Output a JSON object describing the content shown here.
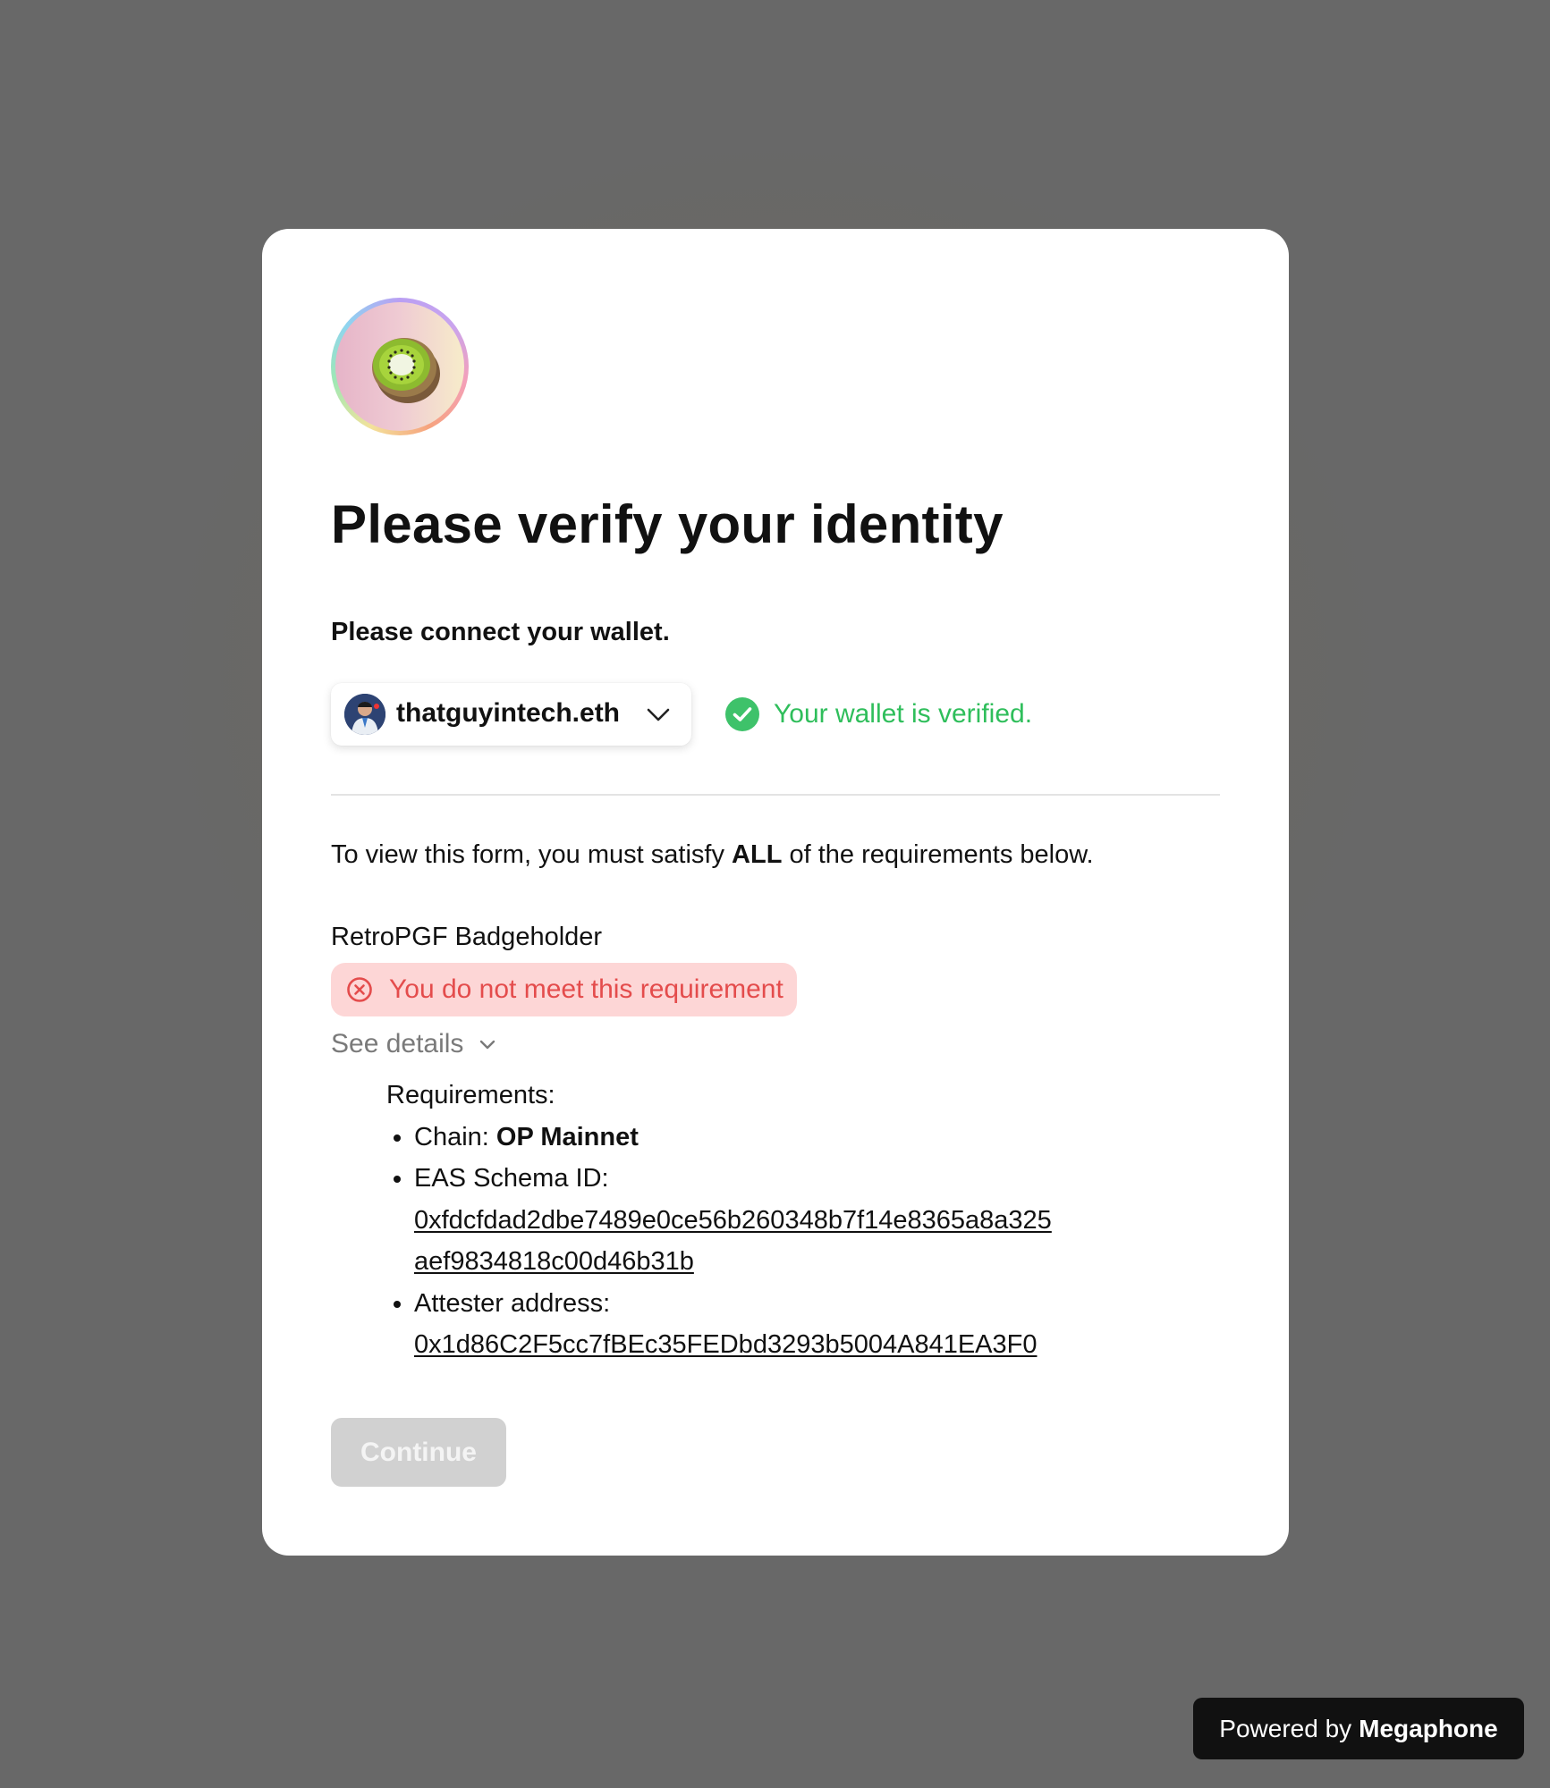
{
  "form": {
    "logo_icon": "kiwi-icon",
    "title": "Please verify your identity",
    "connect_prompt": "Please connect your wallet."
  },
  "wallet": {
    "name": "thatguyintech.eth",
    "avatar_icon": "user-avatar",
    "dropdown_icon": "chevron-down-icon",
    "status_text": "Your wallet is verified.",
    "status_color": "#2fbe5b"
  },
  "requirements": {
    "intro_prefix": "To view this form, you must satisfy",
    "intro_emphasis": "ALL",
    "intro_suffix": "of the requirements below.",
    "items": [
      {
        "name": "RetroPGF Badgeholder",
        "status_text": "You do not meet this requirement",
        "status_color": "#e44c4c",
        "details_toggle": "See details",
        "details": {
          "title": "Requirements:",
          "chain_label": "Chain:",
          "chain_value": "OP Mainnet",
          "schema_label": "EAS Schema ID:",
          "schema_id_line1": "0xfdcfdad2dbe7489e0ce56b260348b7f14e8365a8a325",
          "schema_id_line2": "aef9834818c00d46b31b",
          "attester_label": "Attester address:",
          "attester_address": "0x1d86C2F5cc7fBEc35FEDbd3293b5004A841EA3F0"
        }
      }
    ]
  },
  "actions": {
    "continue_label": "Continue",
    "continue_disabled": true
  },
  "footer": {
    "powered_prefix": "Powered by",
    "powered_brand": "Megaphone"
  }
}
